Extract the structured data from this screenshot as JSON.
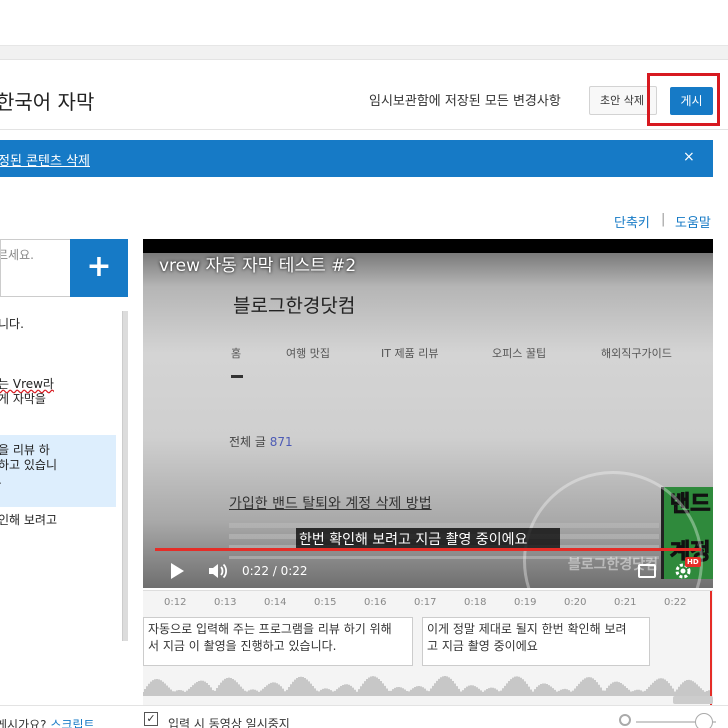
{
  "header": {
    "title": "한국어 자막",
    "saved_message": "임시보관함에 저장된 모든 변경사항",
    "draft_delete_label": "초안 삭제",
    "publish_label": "게시"
  },
  "banner": {
    "link_text": "정된 콘텐츠 삭제",
    "close_label": "×"
  },
  "links": {
    "shortcuts": "단축키",
    "separator": "|",
    "help": "도움말"
  },
  "editor": {
    "input_placeholder": "르세요.",
    "add_label": "+",
    "items": [
      {
        "lines": [
          "니다."
        ],
        "selected": false
      },
      {
        "lines": [
          "는 Vrew라",
          "게 자막을"
        ],
        "selected": false
      },
      {
        "lines": [
          "을 리뷰 하",
          "하고 있습니",
          "."
        ],
        "selected": true
      },
      {
        "lines": [
          "인해 보려고"
        ],
        "selected": false
      }
    ]
  },
  "player": {
    "video_title": "vrew 자동 자막 테스트 #2",
    "blog_name": "블로그한경닷컴",
    "nav": [
      "홈",
      "여행 맛집",
      "IT 제품 리뷰",
      "오피스 꿀팁",
      "해외직구가이드"
    ],
    "post_count_label": "전체 글",
    "post_count": "871",
    "post_title": "가입한 밴드 탈퇴와 계정 삭제 방법",
    "side_image_text": [
      "밴드",
      "계정"
    ],
    "watermark_text": "블로그한경닷컴",
    "caption": "한번 확인해 보려고 지금 촬영 중이에요",
    "time": "0:22 / 0:22",
    "progress": 1.0,
    "hd_badge": "HD"
  },
  "timeline": {
    "ticks": [
      "0:12",
      "0:13",
      "0:14",
      "0:15",
      "0:16",
      "0:17",
      "0:18",
      "0:19",
      "0:20",
      "0:21",
      "0:22"
    ],
    "cues": [
      {
        "lines": [
          "자동으로 입력해 주는 프로그램을 리뷰 하기 위해",
          "서 지금 이 촬영을 진행하고 있습니다."
        ]
      },
      {
        "lines": [
          "이게 정말 제대로 될지 한번 확인해 보려",
          "고 지금 촬영 중이에요"
        ]
      }
    ]
  },
  "footer": {
    "question": "게시가요? ",
    "script_link": "스크립트",
    "pause_label": "입력 시 동영상 일시중지",
    "pause_checked": "✓"
  },
  "colors": {
    "accent": "#167ac6",
    "highlight": "#d71920",
    "progress": "#e52d27"
  }
}
